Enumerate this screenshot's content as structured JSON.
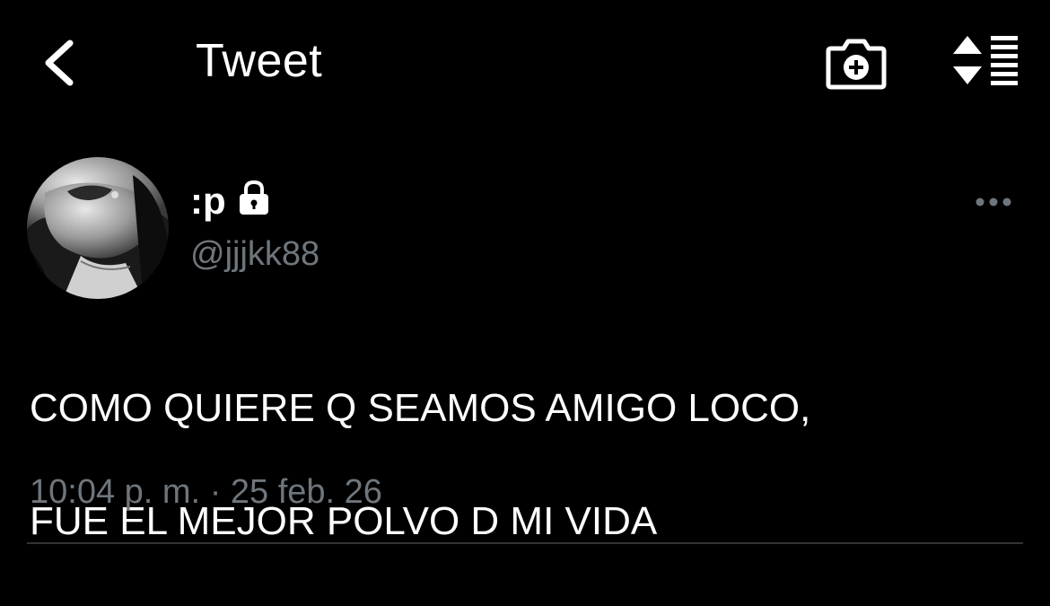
{
  "header": {
    "title": "Tweet",
    "back_icon": "chevron-left-icon",
    "camera_icon": "camera-plus-icon",
    "sort_icon": "sort-list-icon"
  },
  "tweet": {
    "display_name": ":p",
    "locked": true,
    "lock_icon": "lock-icon",
    "handle": "@jjjkk88",
    "more_icon": "more-horizontal-icon",
    "text_line1": "COMO QUIERE Q SEAMOS AMIGO LOCO,",
    "text_line2": "FUE EL MEJOR POLVO D MI VIDA",
    "time": "10:04 p. m.",
    "separator": "·",
    "date": "25 feb. 26"
  },
  "colors": {
    "background": "#000000",
    "text": "#ffffff",
    "secondary_text": "#6e767d",
    "divider": "#2f3336"
  }
}
